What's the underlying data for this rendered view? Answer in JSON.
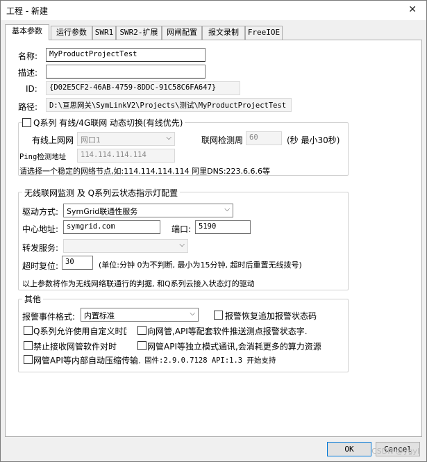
{
  "window": {
    "title": "工程 - 新建",
    "close_glyph": "✕"
  },
  "tabs": [
    "基本参数",
    "运行参数",
    "SWR1",
    "SWR2-扩展",
    "网闸配置",
    "报文录制",
    "FreeIOE"
  ],
  "project": {
    "name_label": "名称:",
    "name_value": "MyProductProjectTest",
    "desc_label": "描述:",
    "desc_value": "",
    "id_label": "ID:",
    "id_value": "{D02E5CF2-46AB-4759-8DDC-91C58C6FA647}",
    "path_label": "路径:",
    "path_value": "D:\\亘思网关\\SymLinkV2\\Projects\\测试\\MyProductProjectTest"
  },
  "qseries": {
    "group_label": "Q系列 有线/4G联网 动态切换(有线优先)",
    "wired_label": "有线上网网",
    "wired_value": "网口1",
    "detect_label": "联网检测周",
    "detect_value": "60",
    "detect_unit": "(秒 最小30秒)",
    "ping_label": "Ping检测地址",
    "ping_value": "114.114.114.114",
    "hint": "请选择一个稳定的网络节点,如:114.114.114.114 阿里DNS:223.6.6.6等"
  },
  "wireless": {
    "group_label": "无线联网监测 及 Q系列云状态指示灯配置",
    "driver_label": "驱动方式:",
    "driver_value": "SymGrid联通性服务",
    "center_label": "中心地址:",
    "center_value": "symgrid.com",
    "port_label": "端口:",
    "port_value": "5190",
    "forward_label": "转发服务:",
    "forward_value": "",
    "timeout_label": "超时复位:",
    "timeout_value": "30",
    "timeout_hint": "(单位:分钟  0为不判断, 最小为15分钟, 超时后重置无线拨号)",
    "note": "以上参数将作为无线网络联通行的判据, 和Q系列云接入状态灯的驱动"
  },
  "other": {
    "group_label": "其他",
    "alarm_label": "报警事件格式:",
    "alarm_value": "内置标准",
    "chk_alarm_restore": "报警恢复追加报警状态码",
    "chk_q_custom_time": "Q系列允许使用自定义时区",
    "chk_api_push": "向网管,API等配套软件推送测点报警状态字.",
    "chk_block_time": "禁止接收网管软件对时",
    "chk_independent": "网管API等独立模式通讯,会消耗更多的算力资源",
    "chk_compress": "网管API等内部自动压缩传输.",
    "firmware": "固件:2.9.0.7128 API:1.3 开始支持"
  },
  "buttons": {
    "ok": "OK",
    "cancel": "Cancel"
  },
  "watermark": "CSDN @ygyl"
}
